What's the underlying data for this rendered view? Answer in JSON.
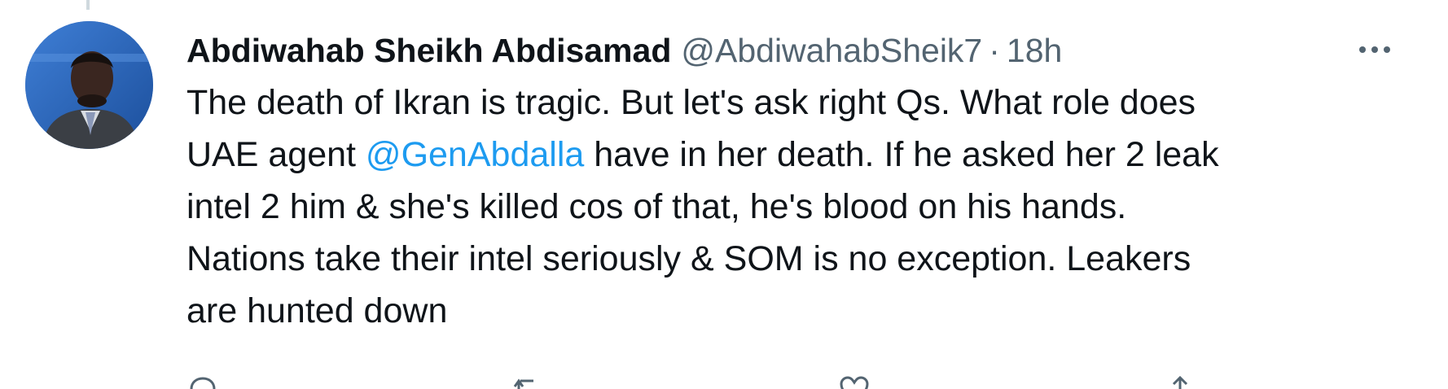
{
  "tweet": {
    "author_name": "Abdiwahab Sheikh Abdisamad",
    "author_handle": "@AbdiwahabSheik7",
    "separator": "·",
    "time": "18h",
    "text_lines": [
      {
        "before": "The death of Ikran is tragic. But let's ask right Qs. What role does",
        "mention": "",
        "after": ""
      },
      {
        "before": "UAE agent ",
        "mention": "@GenAbdalla",
        "after": " have in her death. If he asked her 2 leak"
      },
      {
        "before": "intel 2 him & she's killed cos of that, he's blood on his hands.",
        "mention": "",
        "after": ""
      },
      {
        "before": "Nations take their intel seriously & SOM is no exception. Leakers",
        "mention": "",
        "after": ""
      },
      {
        "before": "are hunted down",
        "mention": "",
        "after": ""
      }
    ]
  },
  "icons": {
    "more": "more-horizontal-icon",
    "reply": "reply-icon",
    "retweet": "retweet-icon",
    "like": "like-icon",
    "share": "share-icon"
  },
  "colors": {
    "text": "#0f1419",
    "secondary": "#536471",
    "link": "#1d9bf0",
    "thread_line": "#cfd9de"
  }
}
